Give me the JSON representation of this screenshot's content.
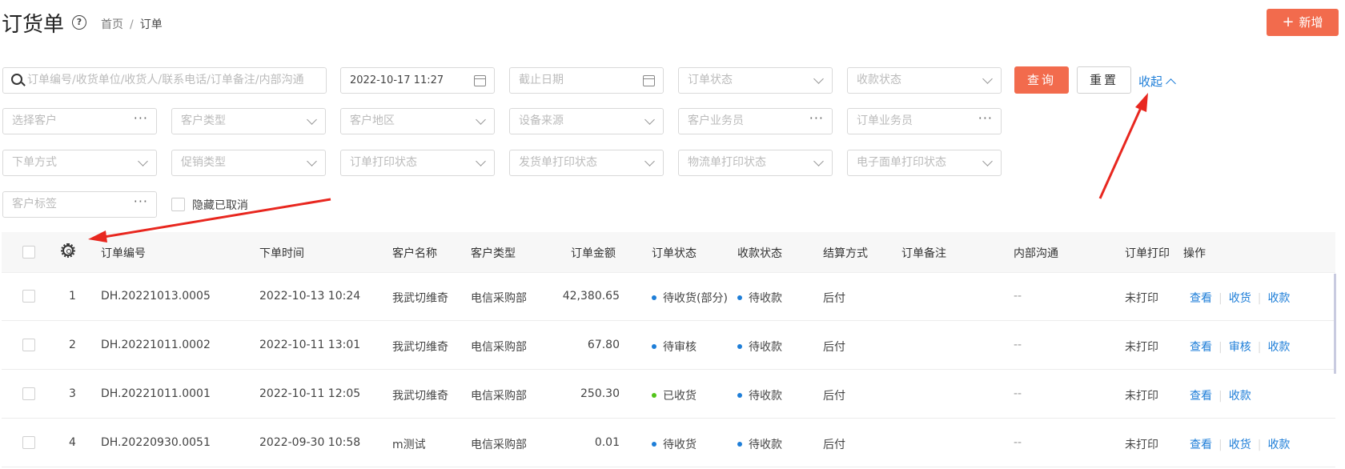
{
  "header": {
    "title": "订货单",
    "breadcrumb": [
      "首页",
      "订单"
    ],
    "add_label": "新增"
  },
  "filters": {
    "search_placeholder": "订单编号/收货单位/收货人/联系电话/订单备注/内部沟通",
    "start_date": "2022-10-17 11:27",
    "end_date_placeholder": "截止日期",
    "order_status": "订单状态",
    "payment_status": "收款状态",
    "customer_select": "选择客户",
    "customer_type": "客户类型",
    "customer_region": "客户地区",
    "device_source": "设备来源",
    "customer_salesman": "客户业务员",
    "order_salesman": "订单业务员",
    "order_method": "下单方式",
    "promo_type": "促销类型",
    "order_print_status": "订单打印状态",
    "ship_print_status": "发货单打印状态",
    "logistics_print_status": "物流单打印状态",
    "eface_print_status": "电子面单打印状态",
    "customer_tag": "客户标签",
    "hide_cancelled": "隐藏已取消",
    "query_label": "查询",
    "reset_label": "重置",
    "collapse_label": "收起"
  },
  "table": {
    "columns": [
      "订单编号",
      "下单时间",
      "客户名称",
      "客户类型",
      "订单金额",
      "订单状态",
      "收款状态",
      "结算方式",
      "订单备注",
      "内部沟通",
      "订单打印",
      "操作"
    ],
    "rows": [
      {
        "idx": "1",
        "no": "DH.20221013.0005",
        "time": "2022-10-13 10:24",
        "customer": "我武切维奇",
        "ctype": "电信采购部",
        "amount": "42,380.65",
        "status": "待收货(部分)",
        "status_color": "#1e7ed8",
        "pay": "待收款",
        "settle": "后付",
        "remark": "",
        "internal": "--",
        "print": "未打印",
        "ops": [
          "查看",
          "收货",
          "收款"
        ]
      },
      {
        "idx": "2",
        "no": "DH.20221011.0002",
        "time": "2022-10-11 13:01",
        "customer": "我武切维奇",
        "ctype": "电信采购部",
        "amount": "67.80",
        "status": "待审核",
        "status_color": "#1e7ed8",
        "pay": "待收款",
        "settle": "后付",
        "remark": "",
        "internal": "--",
        "print": "未打印",
        "ops": [
          "查看",
          "审核",
          "收款"
        ]
      },
      {
        "idx": "3",
        "no": "DH.20221011.0001",
        "time": "2022-10-11 12:05",
        "customer": "我武切维奇",
        "ctype": "电信采购部",
        "amount": "250.30",
        "status": "已收货",
        "status_color": "#52c41a",
        "pay": "待收款",
        "settle": "后付",
        "remark": "",
        "internal": "--",
        "print": "未打印",
        "ops": [
          "查看",
          "收款"
        ]
      },
      {
        "idx": "4",
        "no": "DH.20220930.0051",
        "time": "2022-09-30 10:58",
        "customer": "m测试",
        "ctype": "电信采购部",
        "amount": "0.01",
        "status": "待收货",
        "status_color": "#1e7ed8",
        "pay": "待收款",
        "settle": "后付",
        "remark": "",
        "internal": "--",
        "print": "未打印",
        "ops": [
          "查看",
          "收货",
          "收款"
        ]
      }
    ]
  },
  "colors": {
    "accent": "#f26b4d",
    "link": "#1e7ed8",
    "annotation_arrow": "#e8271f"
  }
}
